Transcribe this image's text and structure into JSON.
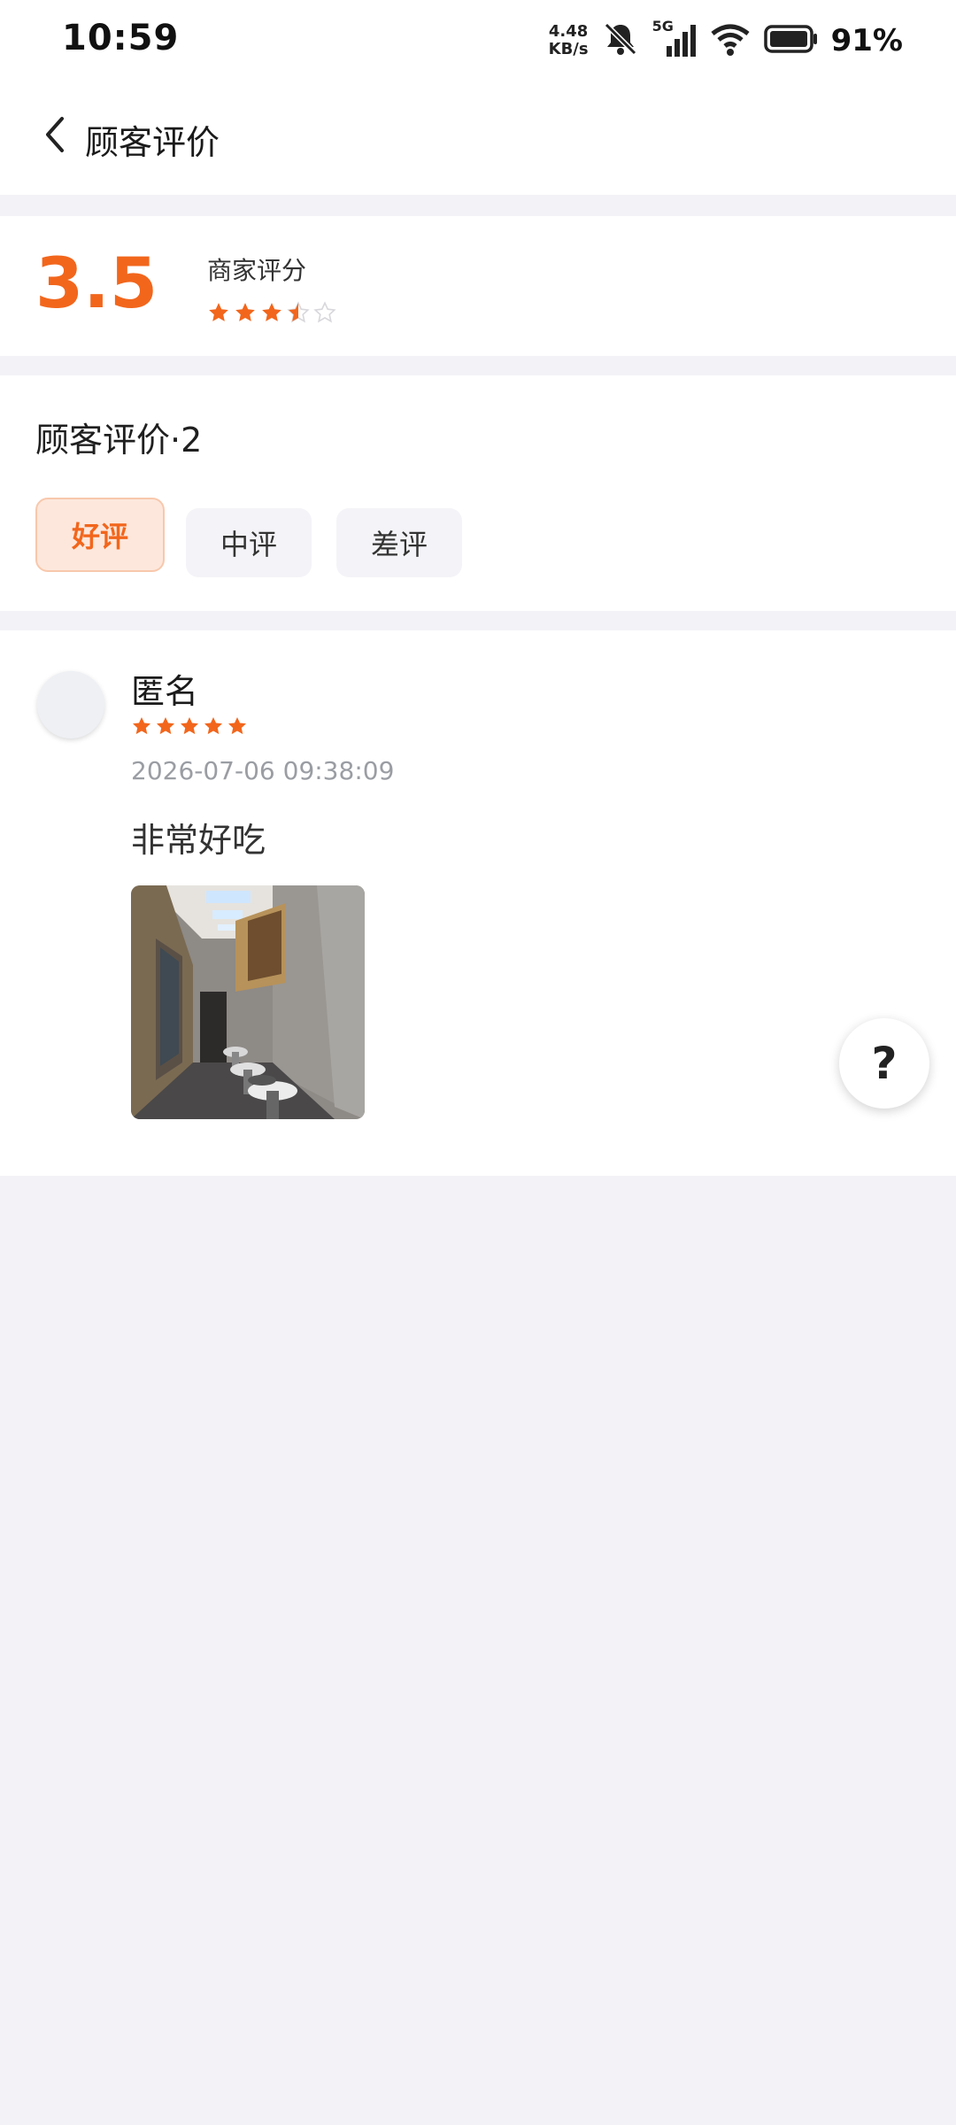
{
  "status_bar": {
    "time": "10:59",
    "net_speed_value": "4.48",
    "net_speed_unit": "KB/s",
    "network": "5G",
    "battery": "91%",
    "icons": [
      "mute-bell-icon",
      "signal-icon",
      "wifi-icon",
      "battery-icon"
    ]
  },
  "nav": {
    "title": "顾客评价",
    "back_icon": "chevron-left-icon"
  },
  "rating": {
    "score": "3.5",
    "label": "商家评分",
    "stars": 3.5
  },
  "reviews": {
    "title": "顾客评价·2",
    "tabs": [
      {
        "label": "好评",
        "active": true
      },
      {
        "label": "中评",
        "active": false
      },
      {
        "label": "差评",
        "active": false
      }
    ],
    "items": [
      {
        "name": "匿名",
        "stars": 5,
        "date": "2026-07-06 09:38:09",
        "text": "非常好吃",
        "photo_icon": "restaurant-photo"
      }
    ]
  },
  "help": {
    "label": "?"
  },
  "colors": {
    "accent": "#f2661c",
    "star_empty": "#d8d8dc",
    "page_bg": "#f3f3f7"
  }
}
